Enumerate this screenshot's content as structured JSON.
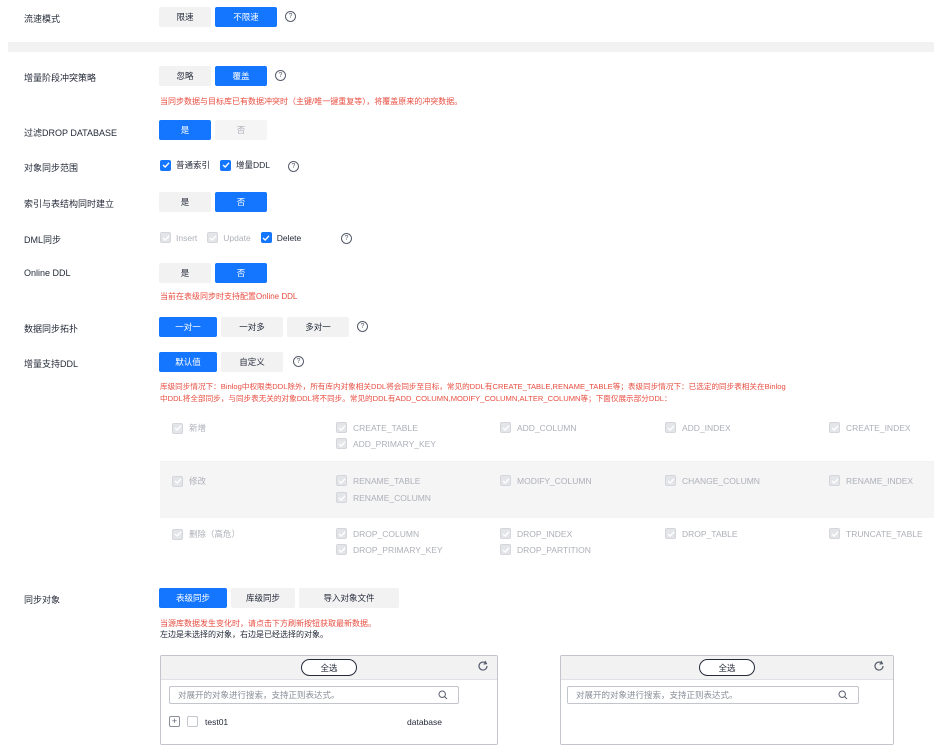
{
  "rows": {
    "flow_mode": {
      "label": "流速模式",
      "options": [
        "限速",
        "不限速"
      ],
      "active": 1
    },
    "conflict": {
      "label": "增量阶段冲突策略",
      "options": [
        "忽略",
        "覆盖"
      ],
      "active": 1,
      "note": "当同步数据与目标库已有数据冲突时（主键/唯一键重复等），将覆盖原来的冲突数据。"
    },
    "filter_drop": {
      "label": "过滤DROP DATABASE",
      "options": [
        "是",
        "否"
      ],
      "active": 0
    },
    "scope": {
      "label": "对象同步范围",
      "items": [
        {
          "text": "普通索引",
          "checked": true
        },
        {
          "text": "增量DDL",
          "checked": true
        }
      ]
    },
    "index_build": {
      "label": "索引与表结构同时建立",
      "options": [
        "是",
        "否"
      ],
      "active": 1
    },
    "dml": {
      "label": "DML同步",
      "items": [
        {
          "text": "Insert",
          "checked": true,
          "disabled": true
        },
        {
          "text": "Update",
          "checked": true,
          "disabled": true
        },
        {
          "text": "Delete",
          "checked": true,
          "disabled": false
        }
      ]
    },
    "online_ddl": {
      "label": "Online DDL",
      "options": [
        "是",
        "否"
      ],
      "active": 1,
      "note": "当前在表级同步时支持配置Online DDL"
    },
    "topology": {
      "label": "数据同步拓扑",
      "options": [
        "一对一",
        "一对多",
        "多对一"
      ],
      "active": 0
    },
    "ddl_support": {
      "label": "增量支持DDL",
      "options": [
        "默认值",
        "自定义"
      ],
      "active": 0,
      "note_line1": "库级同步情况下：Binlog中权限类DDL除外，所有库内对象相关DDL将会同步至目标，常见的DDL有CREATE_TABLE,RENAME_TABLE等；表级同步情况下：已选定的同步表相关在Binlog",
      "note_line2": "中DDL将全部同步，与同步表无关的对象DDL将不同步。常见的DDL有ADD_COLUMN,MODIFY_COLUMN,ALTER_COLUMN等；下面仅展示部分DDL："
    },
    "sync_object": {
      "label": "同步对象",
      "options": [
        "表级同步",
        "库级同步",
        "导入对象文件"
      ],
      "active": 0,
      "note": "当源库数据发生变化时，请点击下方刷新按钮获取最新数据。",
      "note2": "左边是未选择的对象，右边是已经选择的对象。"
    }
  },
  "ddl_groups": [
    {
      "name": "新增",
      "cols": [
        [
          "CREATE_TABLE",
          "ADD_PRIMARY_KEY"
        ],
        [
          "ADD_COLUMN"
        ],
        [
          "ADD_INDEX"
        ],
        [
          "CREATE_INDEX"
        ]
      ]
    },
    {
      "name": "修改",
      "cols": [
        [
          "RENAME_TABLE",
          "RENAME_COLUMN"
        ],
        [
          "MODIFY_COLUMN"
        ],
        [
          "CHANGE_COLUMN"
        ],
        [
          "RENAME_INDEX"
        ]
      ]
    },
    {
      "name": "删除（高危）",
      "cols": [
        [
          "DROP_COLUMN",
          "DROP_PRIMARY_KEY"
        ],
        [
          "DROP_INDEX",
          "DROP_PARTITION"
        ],
        [
          "DROP_TABLE"
        ],
        [
          "TRUNCATE_TABLE"
        ]
      ]
    }
  ],
  "left_panel": {
    "select_all": "全选",
    "search_placeholder": "对展开的对象进行搜索，支持正则表达式。",
    "tree_item": "test01",
    "tree_item_type": "database"
  },
  "right_panel": {
    "select_all": "全选",
    "search_placeholder": "对展开的对象进行搜索，支持正则表达式。"
  },
  "help_glyph": "?",
  "colors": {
    "primary": "#1476ff",
    "danger": "#e84d40",
    "muted": "#adb0b8"
  }
}
